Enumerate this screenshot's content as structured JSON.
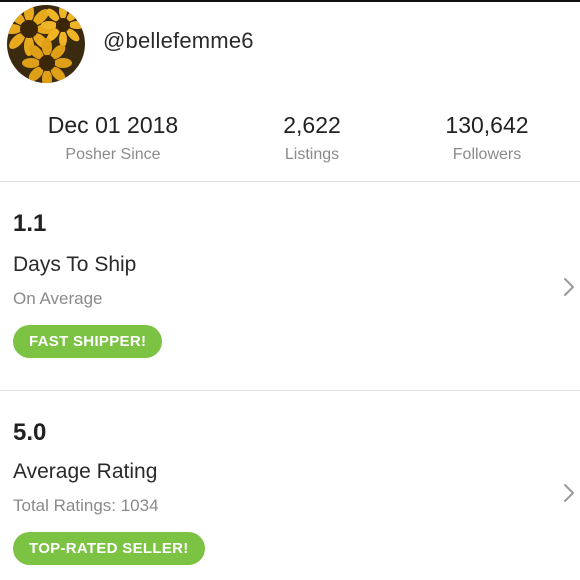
{
  "profile": {
    "username": "@bellefemme6",
    "avatar_icon": "sunflower-avatar-icon"
  },
  "stats": [
    {
      "value": "Dec 01 2018",
      "label": "Posher Since"
    },
    {
      "value": "2,622",
      "label": "Listings"
    },
    {
      "value": "130,642",
      "label": "Followers"
    }
  ],
  "shipping": {
    "value": "1.1",
    "title": "Days To Ship",
    "subtitle": "On Average",
    "badge": "FAST SHIPPER!"
  },
  "rating": {
    "value": "5.0",
    "title": "Average Rating",
    "subtitle": "Total Ratings: 1034",
    "badge": "TOP-RATED SELLER!"
  },
  "colors": {
    "badge_green": "#7cc243",
    "muted_text": "#8a8a8a",
    "divider": "#e3e3e3",
    "chevron": "#9a9a9a"
  },
  "icons": {
    "row_chevron": "chevron-right-icon"
  }
}
